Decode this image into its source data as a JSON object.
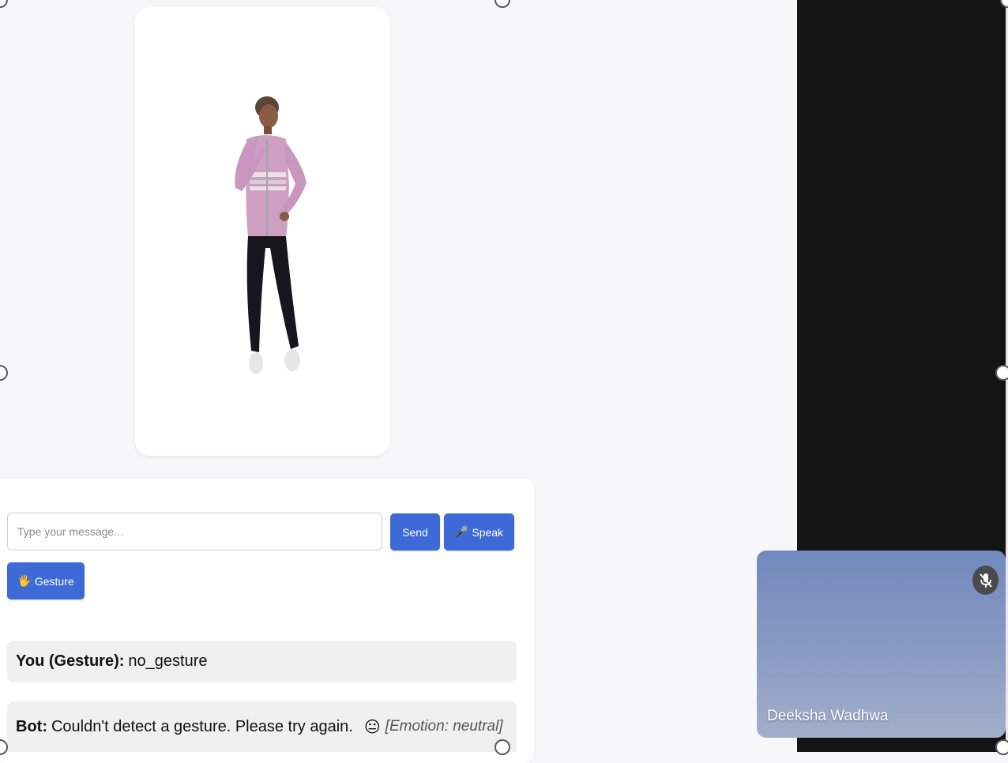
{
  "chat": {
    "input_placeholder": "Type your message...",
    "send_label": "Send",
    "speak_icon": "🎤",
    "speak_label": "Speak",
    "gesture_icon": "🖐️",
    "gesture_label": "Gesture",
    "messages": [
      {
        "speaker": "You (Gesture):",
        "text": "no_gesture"
      },
      {
        "speaker": "Bot:",
        "text": "Couldn't detect a gesture. Please try again.",
        "emoji": "😐",
        "emotion": "[Emotion: neutral]"
      }
    ]
  },
  "video_call": {
    "participant_name": "Deeksha Wadhwa",
    "mute_icon": "mic-off-icon"
  },
  "colors": {
    "button": "#3d6ad6",
    "page_background": "#f7f7f9",
    "dark_panel": "#141414"
  }
}
